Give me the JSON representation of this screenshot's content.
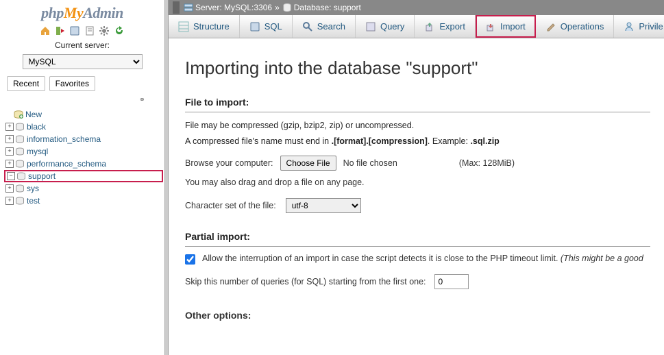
{
  "logo": {
    "p1": "php",
    "p2": "My",
    "p3": "Admin"
  },
  "sidebar": {
    "current_server_label": "Current server:",
    "server_value": "MySQL",
    "recent_btn": "Recent",
    "favorites_btn": "Favorites",
    "databases": [
      {
        "label": "New",
        "new": true,
        "exp": ""
      },
      {
        "label": "black",
        "exp": "+"
      },
      {
        "label": "information_schema",
        "exp": "+"
      },
      {
        "label": "mysql",
        "exp": "+"
      },
      {
        "label": "performance_schema",
        "exp": "+"
      },
      {
        "label": "support",
        "exp": "−",
        "selected": true
      },
      {
        "label": "sys",
        "exp": "+"
      },
      {
        "label": "test",
        "exp": "+"
      }
    ]
  },
  "breadcrumb": {
    "server_label": "Server: MySQL:3306",
    "db_label": "Database: support"
  },
  "tabs": [
    {
      "label": "Structure",
      "name": "tab-structure"
    },
    {
      "label": "SQL",
      "name": "tab-sql"
    },
    {
      "label": "Search",
      "name": "tab-search"
    },
    {
      "label": "Query",
      "name": "tab-query"
    },
    {
      "label": "Export",
      "name": "tab-export"
    },
    {
      "label": "Import",
      "name": "tab-import",
      "highlighted": true
    },
    {
      "label": "Operations",
      "name": "tab-operations"
    },
    {
      "label": "Privile",
      "name": "tab-privileges"
    }
  ],
  "page": {
    "title": "Importing into the database \"support\"",
    "file_section": "File to import:",
    "compress_line1": "File may be compressed (gzip, bzip2, zip) or uncompressed.",
    "compress_line2_a": "A compressed file's name must end in ",
    "compress_line2_b": ".[format].[compression]",
    "compress_line2_c": ". Example: ",
    "compress_line2_d": ".sql.zip",
    "browse_label": "Browse your computer:",
    "choose_btn": "Choose File",
    "no_file": "No file chosen",
    "max": "(Max: 128MiB)",
    "drag_note": "You may also drag and drop a file on any page.",
    "charset_label": "Character set of the file:",
    "charset_value": "utf-8",
    "partial_section": "Partial import:",
    "allow_text": "Allow the interruption of an import in case the script detects it is close to the PHP timeout limit. ",
    "allow_hint": "(This might be a good",
    "skip_label": "Skip this number of queries (for SQL) starting from the first one:",
    "skip_value": "0",
    "other_section": "Other options:"
  }
}
